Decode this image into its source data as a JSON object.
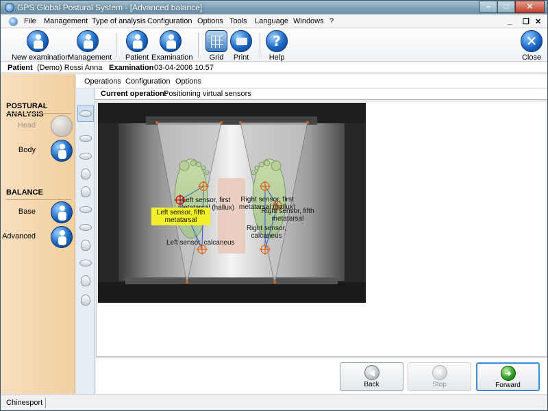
{
  "window": {
    "title": "GPS Global Postural System - [Advanced balance]",
    "min": "–",
    "max": "□",
    "close": "✕"
  },
  "menu": {
    "items": [
      "File",
      "Management",
      "Type of analysis",
      "Configuration",
      "Options",
      "Tools",
      "Language",
      "Windows",
      "?"
    ],
    "mdi_min": "_",
    "mdi_restore": "❐",
    "mdi_close": "✕"
  },
  "toolbar": {
    "new_examination": "New examination",
    "management": "Management",
    "patient": "Patient",
    "examination": "Examination",
    "grid": "Grid",
    "print": "Print",
    "help": "Help",
    "help_glyph": "?",
    "close": "Close",
    "close_glyph": "✕"
  },
  "patient_bar": {
    "patient_label": "Patient",
    "patient_value": "(Demo) Rossi Anna",
    "exam_label": "Examination",
    "exam_value": "03-04-2006 10.57"
  },
  "left_panel": {
    "postural_title": "POSTURAL ANALYSIS",
    "head": "Head",
    "body": "Body",
    "balance_title": "BALANCE",
    "base": "Base",
    "advanced": "Advanced"
  },
  "submenu": {
    "items": [
      "Operations",
      "Configuration",
      "Options"
    ]
  },
  "current_operation": {
    "label": "Current operation:",
    "value": "Positioning virtual sensors"
  },
  "sensors": {
    "left_first": "Left sensor, first metatarsal (hallux)",
    "left_fifth": "Left sensor, fifth metatarsal",
    "left_calcaneus": "Left sensor, calcaneus",
    "right_first": "Right sensor, first metatarsal (hallux)",
    "right_fifth": "Right sensor, fifth metatarsal",
    "right_calcaneus": "Right sensor, calcaneus"
  },
  "nav_buttons": {
    "back": "Back",
    "back_glyph": "◀",
    "stop": "Stop",
    "stop_glyph": "✕",
    "forward": "Forward",
    "forward_glyph": "➜"
  },
  "status_bar": {
    "company": "Chinesport"
  },
  "colors": {
    "left_panel": "#f2cf9f",
    "accent_blue": "#1a66c2",
    "highlight_label": "#f2f02a",
    "sensor_target": "#e06010"
  }
}
